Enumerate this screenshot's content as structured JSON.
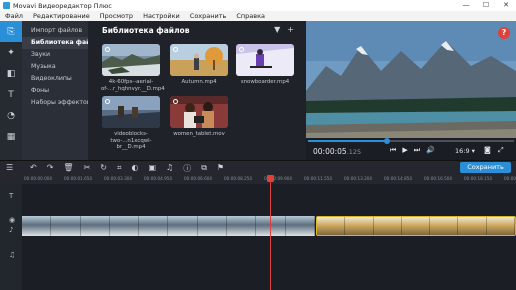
{
  "window": {
    "title": "Movavi Видеоредактор Плюс",
    "controls": [
      "—",
      "☐",
      "✕"
    ]
  },
  "menu": [
    "Файл",
    "Редактирование",
    "Просмотр",
    "Настройки",
    "Сохранить",
    "Справка"
  ],
  "rail": [
    "import-icon",
    "effects-icon",
    "transitions-icon",
    "titles-icon",
    "stickers-icon",
    "more-icon"
  ],
  "categories": [
    "Импорт файлов",
    "Библиотека файлов",
    "Звуки",
    "Музыка",
    "Видеоклипы",
    "Фоны",
    "Наборы эффектов"
  ],
  "library": {
    "title": "Библиотека файлов",
    "filter_icon": "▼",
    "add_icon": "+",
    "items": [
      {
        "caption": "4k-60fps--aerial-of-...r_hqhnvyr.__D.mp4"
      },
      {
        "caption": "Autumn.mp4"
      },
      {
        "caption": "snowboarder.mp4"
      },
      {
        "caption": "videoblocks-two-...n1xcqwl-br__D.mp4"
      },
      {
        "caption": "women_tablet.mov"
      }
    ]
  },
  "player": {
    "time": "00:00:05",
    "time_ms": ".125",
    "ratio": "16:9 ▾",
    "progress": 0.38,
    "help": "?"
  },
  "timeline": {
    "save_label": "Сохранить",
    "ticks": [
      "00:00:00.000",
      "00:00:01.650",
      "00:00:03.300",
      "00:00:04.950",
      "00:00:06.600",
      "00:00:08.250",
      "00:00:09.900",
      "00:00:11.550",
      "00:00:13.200",
      "00:00:14.850",
      "00:00:16.500",
      "00:00:18.150",
      "00:00:19.800"
    ]
  }
}
